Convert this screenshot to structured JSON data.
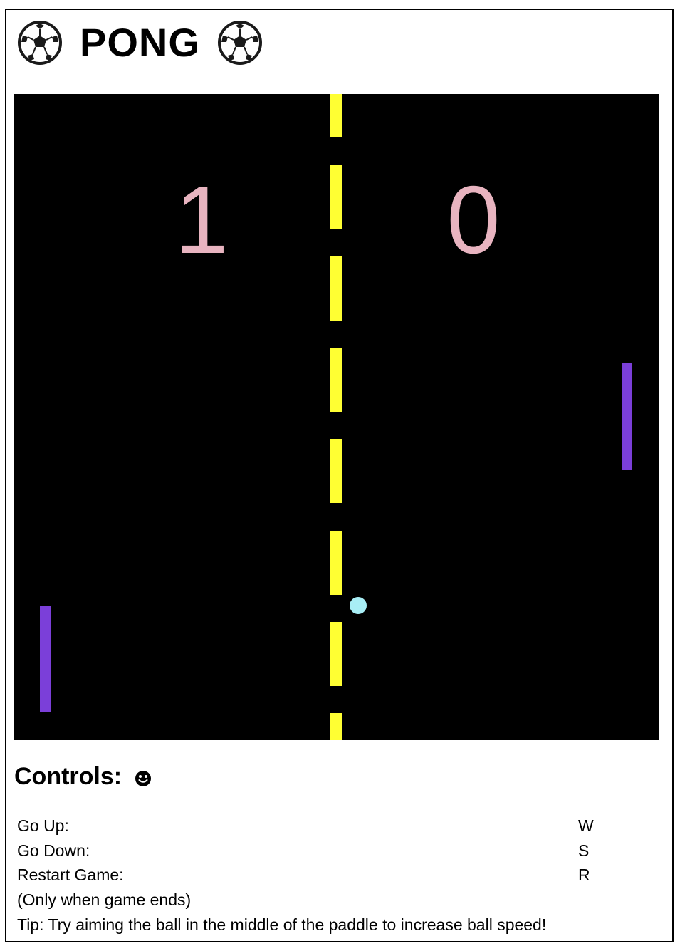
{
  "header": {
    "title": "PONG",
    "left_icon": "soccer-ball-icon",
    "right_icon": "soccer-ball-icon"
  },
  "game": {
    "score_left": "1",
    "score_right": "0",
    "colors": {
      "background": "#000000",
      "center_line": "#ffff33",
      "score": "#e8b4c0",
      "paddle": "#7b3fd9",
      "ball": "#a8eef5"
    }
  },
  "controls": {
    "title": "Controls:",
    "icon": "smiley-face-icon",
    "rows": [
      {
        "label": "Go Up:",
        "key": "W"
      },
      {
        "label": "Go Down:",
        "key": "S"
      },
      {
        "label": "Restart Game:",
        "key": "R"
      }
    ],
    "restart_note": "(Only when game ends)",
    "tip": "Tip: Try aiming the ball in the middle of the paddle to increase ball speed!"
  }
}
